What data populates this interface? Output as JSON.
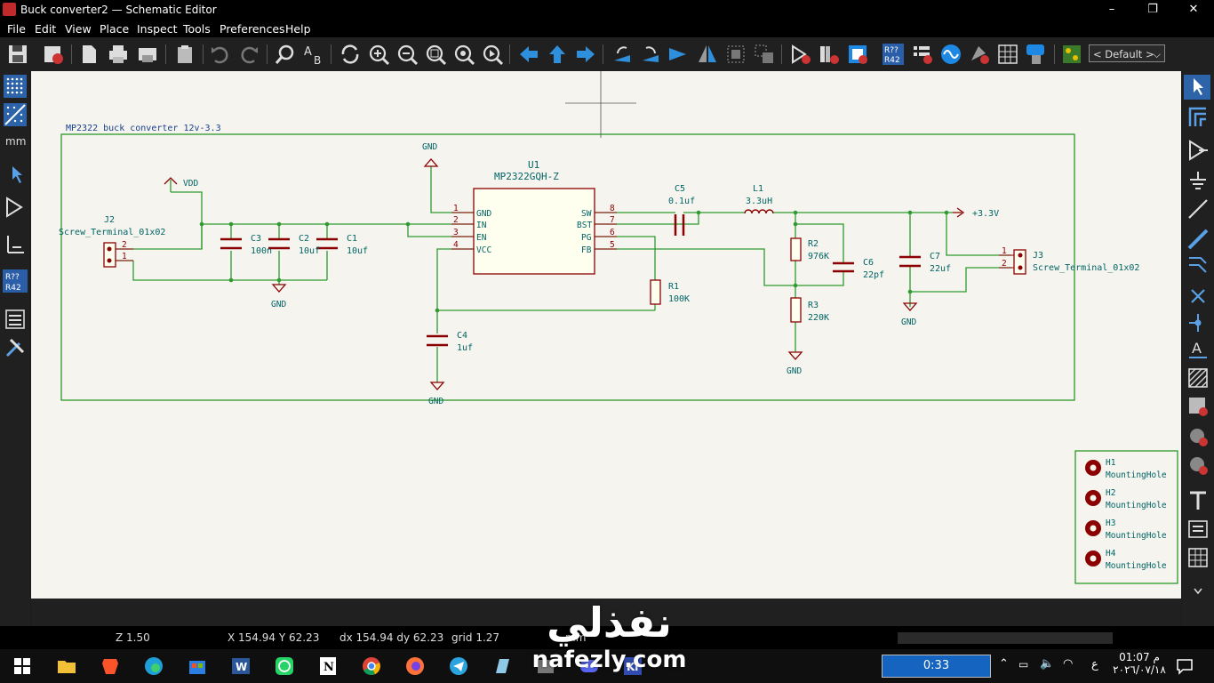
{
  "window": {
    "title": "Buck converter2 — Schematic Editor",
    "minimize_glyph": "–",
    "maximize_glyph": "❐",
    "close_glyph": "✕"
  },
  "menu": [
    "File",
    "Edit",
    "View",
    "Place",
    "Inspect",
    "Tools",
    "Preferences",
    "Help"
  ],
  "toolbar": {
    "icons": [
      "save-icon",
      "schematic-setup-icon",
      "page-settings-icon",
      "print-icon",
      "plot-icon",
      "paste-icon",
      "undo-icon",
      "redo-icon",
      "find-icon",
      "find-replace-icon",
      "refresh-icon",
      "zoom-in-icon",
      "zoom-out-icon",
      "zoom-fit-icon",
      "zoom-objects-icon",
      "zoom-tool-icon",
      "navigate-back-icon",
      "navigate-up-icon",
      "navigate-forward-icon",
      "rotate-ccw-icon",
      "rotate-cw-icon",
      "mirror-v-icon",
      "mirror-h-icon",
      "edit-symbol-icon",
      "update-symbols-icon",
      "symbol-editor-icon",
      "symbol-browser-icon",
      "annotate-icon",
      "erc-icon",
      "simulator-icon",
      "footprint-assign-icon",
      "footprint-table-icon",
      "bom-icon",
      "pcb-editor-icon"
    ],
    "preset_select": "< Default >"
  },
  "left_toolbar": {
    "icons": [
      "grid-dots-icon",
      "grid-overrides-icon",
      "units-icon",
      "cursor-icon",
      "hierarchy-icon",
      "netclass-icon",
      "annotation-icon",
      "properties-icon",
      "settings-icon"
    ],
    "units_label": "mm",
    "ref_label_top": "R??",
    "ref_label_bottom": "R42"
  },
  "right_toolbar": {
    "icons": [
      "select-icon",
      "highlight-net-icon",
      "add-symbol-icon",
      "add-power-icon",
      "add-wire-icon",
      "add-bus-icon",
      "wire-entry-icon",
      "no-connect-icon",
      "junction-icon",
      "net-label-icon",
      "global-label-icon",
      "hier-label-icon",
      "hier-sheet-icon",
      "import-sheet-pin-icon",
      "hier-pin-icon",
      "text-icon",
      "text-box-icon",
      "table-icon"
    ]
  },
  "schematic": {
    "frame_title": "MP2322 buck converter 12v-3.3",
    "u1_ref": "U1",
    "u1_value": "MP2322GQH-Z",
    "u1_left_pins": [
      {
        "num": "1",
        "name": "GND"
      },
      {
        "num": "2",
        "name": "IN"
      },
      {
        "num": "3",
        "name": "EN"
      },
      {
        "num": "4",
        "name": "VCC"
      }
    ],
    "u1_right_pins": [
      {
        "num": "8",
        "name": "SW"
      },
      {
        "num": "7",
        "name": "BST"
      },
      {
        "num": "6",
        "name": "PG"
      },
      {
        "num": "5",
        "name": "FB"
      }
    ],
    "gnd": "GND",
    "vdd": "VDD",
    "out": "+3.3V",
    "j2_ref": "J2",
    "j2_value": "Screw_Terminal_01x02",
    "j3_ref": "J3",
    "j3_value": "Screw_Terminal_01x02",
    "pin1": "1",
    "pin2": "2",
    "c3_ref": "C3",
    "c3_value": "100n",
    "c2_ref": "C2",
    "c2_value": "10uf",
    "c1_ref": "C1",
    "c1_value": "10uf",
    "c4_ref": "C4",
    "c4_value": "1uf",
    "c5_ref": "C5",
    "c5_value": "0.1uf",
    "l1_ref": "L1",
    "l1_value": "3.3uH",
    "r1_ref": "R1",
    "r1_value": "100K",
    "r2_ref": "R2",
    "r2_value": "976K",
    "r3_ref": "R3",
    "r3_value": "220K",
    "c6_ref": "C6",
    "c6_value": "22pf",
    "c7_ref": "C7",
    "c7_value": "22uf",
    "holes": [
      {
        "ref": "H1",
        "value": "MountingHole"
      },
      {
        "ref": "H2",
        "value": "MountingHole"
      },
      {
        "ref": "H3",
        "value": "MountingHole"
      },
      {
        "ref": "H4",
        "value": "MountingHole"
      }
    ],
    "colors": {
      "wire": "#2f9a2f",
      "body": "#8b0000",
      "fill": "#fffff0",
      "text": "#006464",
      "frame": "#1a8f1a"
    }
  },
  "status": {
    "zoom": "Z 1.50",
    "xy": "X 154.94  Y 62.23",
    "dxdy": "dx 154.94  dy 62.23",
    "grid": "grid 1.27",
    "units": "mm"
  },
  "taskbar": {
    "icons": [
      "windows-start-icon",
      "file-explorer-icon",
      "brave-icon",
      "edge-icon",
      "store-icon",
      "word-icon",
      "whatsapp-icon",
      "notion-icon",
      "chrome-icon",
      "firefox-icon",
      "telegram-icon",
      "notes-icon",
      "kicad-folder-icon",
      "discord-icon",
      "kicad-icon"
    ],
    "timer": "0:33",
    "clock_time": "01:07 م",
    "clock_date": "٢٠٢٦/٠٧/١٨",
    "lang": "ع"
  },
  "watermark": {
    "arabic": "نفذلي",
    "latin": "nafezly.com"
  }
}
